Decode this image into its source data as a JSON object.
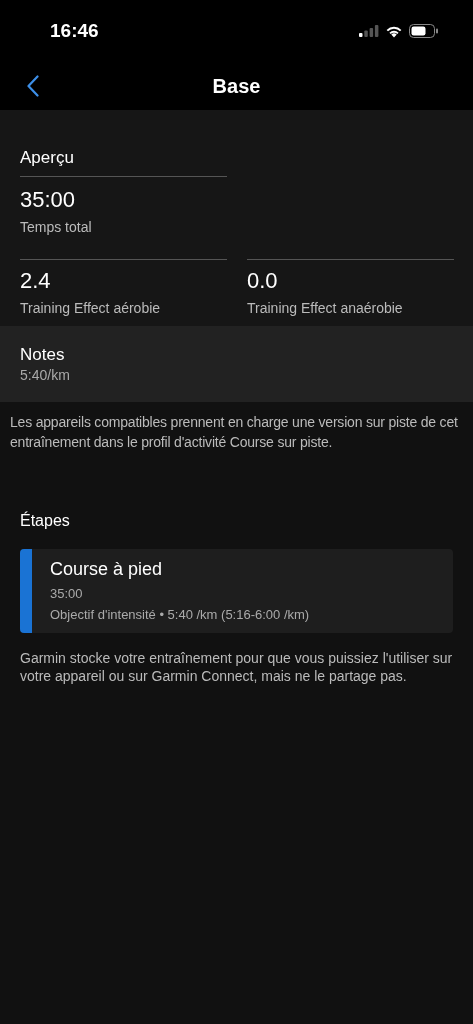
{
  "status_bar": {
    "time": "16:46"
  },
  "nav": {
    "title": "Base"
  },
  "overview": {
    "heading": "Aperçu",
    "total": {
      "value": "35:00",
      "label": "Temps total"
    },
    "metrics": [
      {
        "value": "2.4",
        "label": "Training Effect aérobie"
      },
      {
        "value": "0.0",
        "label": "Training Effect anaérobie"
      }
    ]
  },
  "notes": {
    "heading": "Notes",
    "text": "5:40/km"
  },
  "compat_note": "Les appareils compatibles prennent en charge une version sur piste de cet entraînement dans le profil d'activité Course sur piste.",
  "steps": {
    "heading": "Étapes",
    "items": [
      {
        "title": "Course à pied",
        "duration": "35:00",
        "target": "Objectif d'intensité • 5:40 /km (5:16-6:00 /km)",
        "color": "#1a73d4"
      }
    ]
  },
  "footer_note": "Garmin stocke votre entraînement pour que vous puissiez l'utiliser sur votre appareil ou sur Garmin Connect, mais ne le partage pas."
}
